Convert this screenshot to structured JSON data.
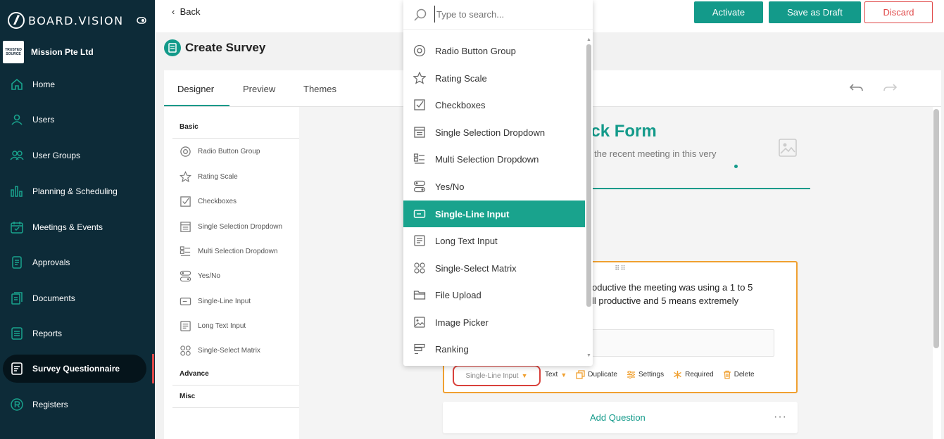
{
  "app": {
    "brand": "BOARD.VISION",
    "org_logo_text": "TRUSTED SOURCE",
    "org_name": "Mission Pte Ltd"
  },
  "sidebar": {
    "items": [
      {
        "label": "Home",
        "icon": "home-icon"
      },
      {
        "label": "Users",
        "icon": "user-icon"
      },
      {
        "label": "User Groups",
        "icon": "user-group-icon"
      },
      {
        "label": "Planning & Scheduling",
        "icon": "planning-icon"
      },
      {
        "label": "Meetings & Events",
        "icon": "calendar-icon"
      },
      {
        "label": "Approvals",
        "icon": "approvals-icon"
      },
      {
        "label": "Documents",
        "icon": "documents-icon"
      },
      {
        "label": "Reports",
        "icon": "reports-icon"
      },
      {
        "label": "Survey Questionnaire",
        "icon": "survey-icon",
        "active": true
      },
      {
        "label": "Registers",
        "icon": "registers-icon"
      }
    ]
  },
  "topbar": {
    "back_label": "Back",
    "activate_label": "Activate",
    "draft_label": "Save as Draft",
    "discard_label": "Discard"
  },
  "page": {
    "title": "Create Survey"
  },
  "tabs": [
    {
      "label": "Designer",
      "active": true
    },
    {
      "label": "Preview"
    },
    {
      "label": "Themes"
    }
  ],
  "palette": {
    "basic_label": "Basic",
    "items": [
      "Radio Button Group",
      "Rating Scale",
      "Checkboxes",
      "Single Selection Dropdown",
      "Multi Selection Dropdown",
      "Yes/No",
      "Single-Line Input",
      "Long Text Input",
      "Single-Select Matrix"
    ],
    "advance_label": "Advance",
    "misc_label": "Misc"
  },
  "form": {
    "title_visible": "ack Form",
    "description_visible": "ng the recent meeting in this very"
  },
  "question": {
    "text_line1": "oductive the meeting was using a 1 to 5",
    "text_line2": "ll productive and 5 means extremely",
    "type_label": "Single-Line Input",
    "input_type_label": "Text",
    "duplicate_label": "Duplicate",
    "settings_label": "Settings",
    "required_label": "Required",
    "delete_label": "Delete"
  },
  "add_question_label": "Add Question",
  "more_label": "···",
  "dropdown": {
    "search_placeholder": "Type to search...",
    "items": [
      "Radio Button Group",
      "Rating Scale",
      "Checkboxes",
      "Single Selection Dropdown",
      "Multi Selection Dropdown",
      "Yes/No",
      "Single-Line Input",
      "Long Text Input",
      "Single-Select Matrix",
      "File Upload",
      "Image Picker",
      "Ranking"
    ],
    "selected": "Single-Line Input"
  },
  "colors": {
    "accent": "#139a8a",
    "sidebar_bg": "#0d2b38",
    "highlight": "#f0a030",
    "danger": "#e04848"
  }
}
